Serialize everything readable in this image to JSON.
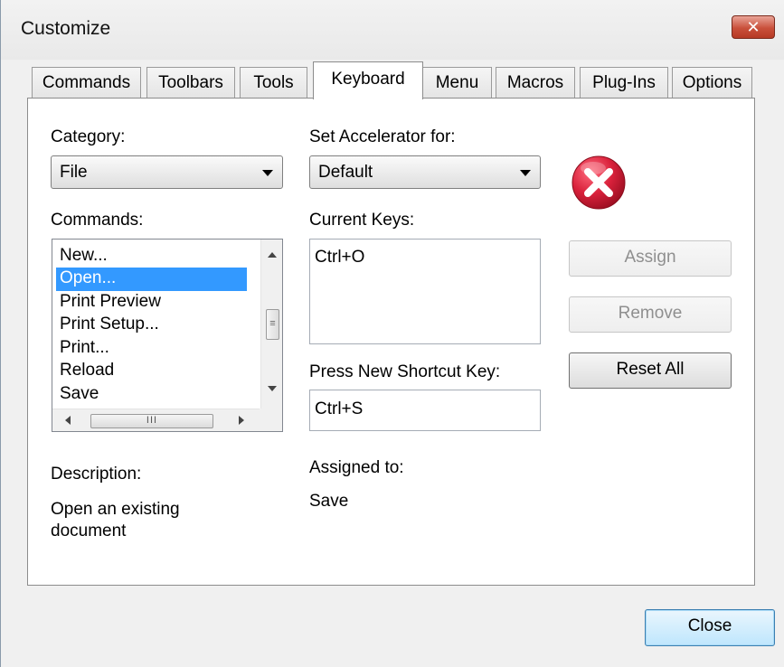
{
  "window": {
    "title": "Customize",
    "close_glyph": "✕"
  },
  "tabs": [
    {
      "label": "Commands"
    },
    {
      "label": "Toolbars"
    },
    {
      "label": "Tools"
    },
    {
      "label": "Keyboard"
    },
    {
      "label": "Menu"
    },
    {
      "label": "Macros"
    },
    {
      "label": "Plug-Ins"
    },
    {
      "label": "Options"
    }
  ],
  "active_tab": "Keyboard",
  "keyboard": {
    "category_label": "Category:",
    "category_value": "File",
    "set_accelerator_label": "Set Accelerator for:",
    "set_accelerator_value": "Default",
    "commands_label": "Commands:",
    "commands": [
      "New...",
      "Open...",
      "Print Preview",
      "Print Setup...",
      "Print...",
      "Reload",
      "Save"
    ],
    "selected_command": "Open...",
    "current_keys_label": "Current Keys:",
    "current_keys": [
      "Ctrl+O"
    ],
    "press_new_label": "Press New Shortcut Key:",
    "new_shortcut_value": "Ctrl+S",
    "assigned_to_label": "Assigned to:",
    "assigned_to_value": "Save",
    "description_label": "Description:",
    "description_text": "Open an existing document",
    "assign_label": "Assign",
    "remove_label": "Remove",
    "reset_all_label": "Reset All",
    "scroll_thumb_v": "≡",
    "scroll_thumb_h": "III"
  },
  "footer": {
    "close_label": "Close"
  },
  "icons": {
    "conflict": "error-x-icon"
  },
  "colors": {
    "selection": "#3399ff",
    "error_red": "#d31f3a"
  }
}
